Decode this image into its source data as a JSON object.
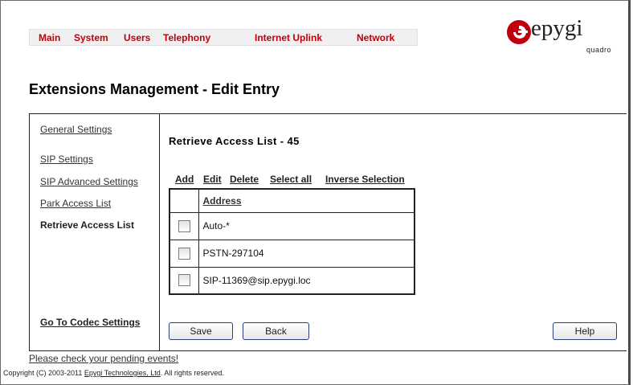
{
  "nav": {
    "items": [
      {
        "label": "Main"
      },
      {
        "label": "System"
      },
      {
        "label": "Users"
      },
      {
        "label": "Telephony"
      },
      {
        "label": "Internet Uplink"
      },
      {
        "label": "Network"
      }
    ]
  },
  "logo": {
    "brand": "epygi",
    "product": "quadro",
    "accent_color": "#c0000c"
  },
  "page_title": "Extensions Management - Edit Entry",
  "sidebar": {
    "items": [
      {
        "label": "General Settings"
      },
      {
        "label": "SIP Settings"
      },
      {
        "label": "SIP Advanced Settings"
      },
      {
        "label": "Park Access List"
      },
      {
        "label": "Retrieve Access List"
      }
    ],
    "codec_link": "Go To Codec Settings"
  },
  "section_title": "Retrieve Access List - 45",
  "actions": [
    "Add",
    "Edit",
    "Delete",
    "Select all",
    "Inverse Selection"
  ],
  "table": {
    "header": "Address",
    "rows": [
      {
        "address": "Auto-*"
      },
      {
        "address": "PSTN-297104"
      },
      {
        "address": "SIP-11369@sip.epygi.loc"
      }
    ]
  },
  "buttons": {
    "save": "Save",
    "back": "Back",
    "help": "Help"
  },
  "footer": {
    "pending": "Please check your pending events!",
    "copyright_prefix": "Copyright (C) 2003-2011",
    "company": "Epygi Technologies, Ltd",
    "copyright_suffix": ". All rights reserved."
  }
}
